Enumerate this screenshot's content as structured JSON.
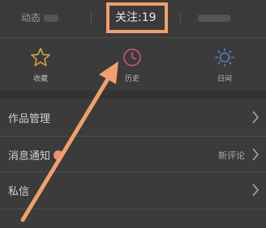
{
  "stats": {
    "dynamic_label": "动态",
    "follow_text": "关注:19",
    "fans_label": ""
  },
  "shortcuts": [
    {
      "label": "收藏",
      "icon": "star-icon",
      "color": "#d9a441"
    },
    {
      "label": "历史",
      "icon": "clock-icon",
      "color": "#c9567a"
    },
    {
      "label": "日间",
      "icon": "sun-icon",
      "color": "#5d7fc6"
    }
  ],
  "menu": [
    {
      "label": "作品管理"
    },
    {
      "label": "消息通知",
      "right_text": "新评论"
    },
    {
      "label": "私信"
    }
  ],
  "annotation": {
    "highlight_color": "#f29f6b"
  }
}
